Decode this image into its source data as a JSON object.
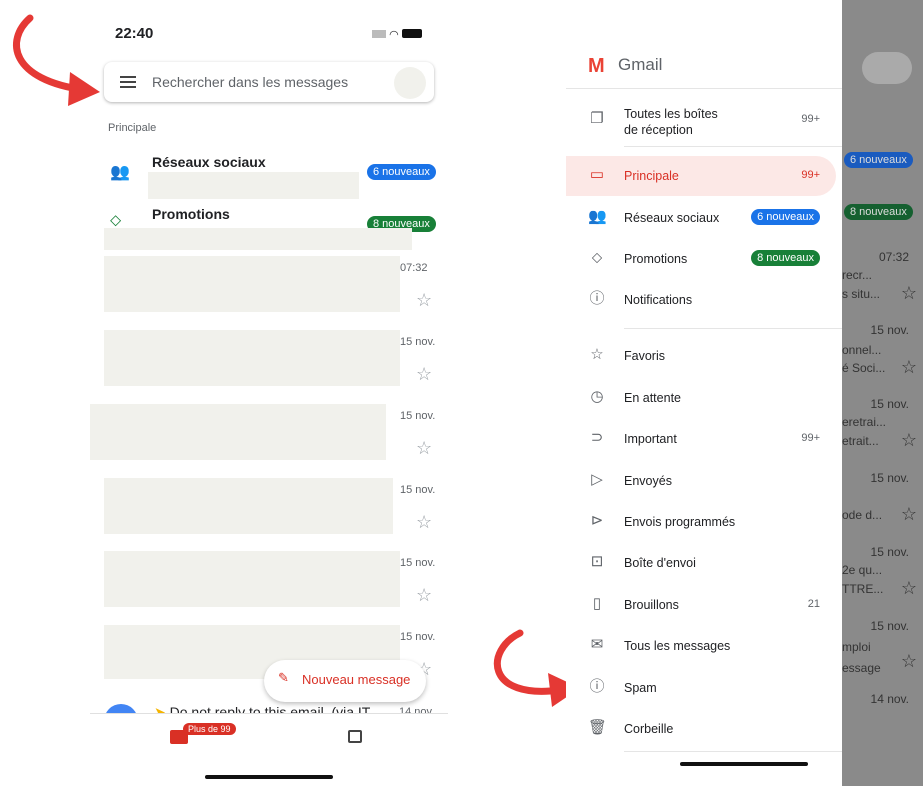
{
  "left": {
    "status_time": "22:40",
    "search_placeholder": "Rechercher dans les messages",
    "section_label": "Principale",
    "categories": [
      {
        "label": "Réseaux sociaux",
        "badge": "6 nouveaux",
        "color": "#1a73e8"
      },
      {
        "label": "Promotions",
        "badge": "8 nouveaux",
        "color": "#188038"
      }
    ],
    "dates": [
      "07:32",
      "15 nov.",
      "15 nov.",
      "15 nov.",
      "15 nov.",
      "15 nov.",
      "14 nov."
    ],
    "last_message": "Do not reply to this email. (via IT",
    "fab_label": "Nouveau message",
    "mail_badge": "Plus de 99"
  },
  "drawer": {
    "brand": "Gmail",
    "items": [
      {
        "label": "Toutes les boîtes de réception",
        "count": "99+",
        "icon": "inbox-stack-icon"
      },
      {
        "label": "Principale",
        "count": "99+",
        "icon": "inbox-icon",
        "active": true
      },
      {
        "label": "Réseaux sociaux",
        "badge": "6 nouveaux",
        "icon": "people-icon"
      },
      {
        "label": "Promotions",
        "badge": "8 nouveaux",
        "icon": "tag-icon"
      },
      {
        "label": "Notifications",
        "icon": "info-icon"
      },
      {
        "label": "Favoris",
        "icon": "star-icon"
      },
      {
        "label": "En attente",
        "icon": "clock-icon"
      },
      {
        "label": "Important",
        "count": "99+",
        "icon": "important-icon"
      },
      {
        "label": "Envoyés",
        "icon": "send-icon"
      },
      {
        "label": "Envois programmés",
        "icon": "scheduled-send-icon"
      },
      {
        "label": "Boîte d'envoi",
        "icon": "outbox-icon"
      },
      {
        "label": "Brouillons",
        "count": "21",
        "icon": "draft-icon"
      },
      {
        "label": "Tous les messages",
        "icon": "all-mail-icon"
      },
      {
        "label": "Spam",
        "icon": "spam-icon"
      },
      {
        "label": "Corbeille",
        "icon": "trash-icon"
      }
    ]
  },
  "background": {
    "badges": [
      "6 nouveaux",
      "8 nouveaux"
    ],
    "snippets": [
      "07:32",
      "recr...",
      "s situ...",
      "15 nov.",
      "onnel...",
      "é Soci...",
      "15 nov.",
      "eretrai...",
      "etrait...",
      "15 nov.",
      "ode d...",
      "15 nov.",
      "2e qu...",
      "TTRE...",
      "15 nov.",
      "mploi",
      "essage",
      "14 nov."
    ]
  },
  "colors": {
    "accent": "#d93025",
    "active_bg": "#fce8e6",
    "blue": "#1a73e8",
    "green": "#188038"
  }
}
